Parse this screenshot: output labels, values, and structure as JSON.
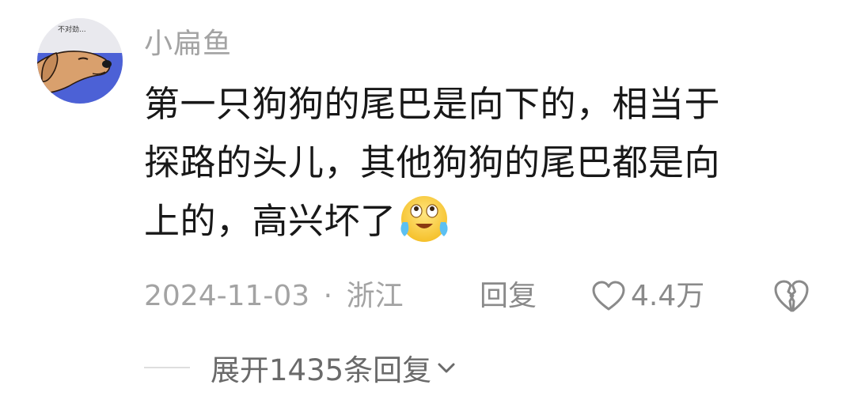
{
  "comment": {
    "avatar_caption": "不对劲...",
    "username": "小扁鱼",
    "text_lines": [
      "第一只狗狗的尾巴是向下的，相当于",
      "探路的头儿，其他狗狗的尾巴都是向",
      "上的，高兴坏了"
    ],
    "emoji": "crying-laughing-emoji",
    "date": "2024-11-03",
    "separator": "·",
    "location": "浙江",
    "reply_label": "回复",
    "like_count": "4.4万",
    "icons": [
      "heart-icon",
      "broken-heart-icon",
      "chevron-down-icon"
    ],
    "colors": {
      "meta_text": "#a3a3a3",
      "main_text": "#181818",
      "avatar_bg": "#4c61d6",
      "dog": "#d9a06d"
    }
  },
  "replies": {
    "expand_label": "展开1435条回复"
  }
}
